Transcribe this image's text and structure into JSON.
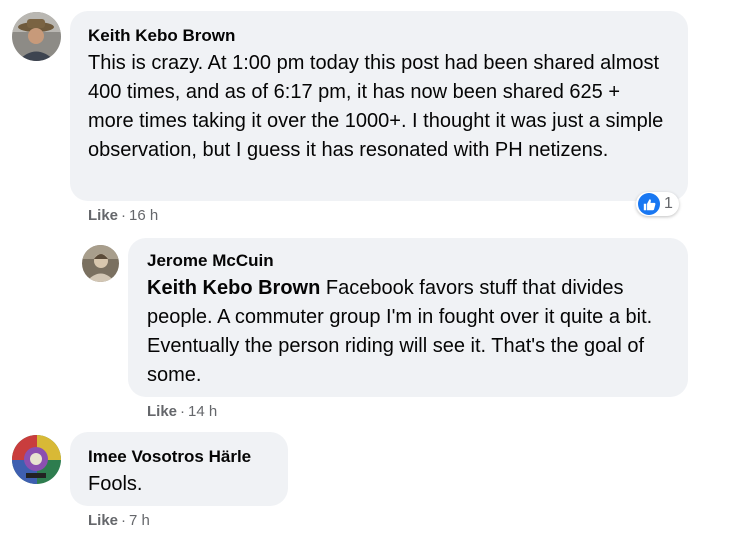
{
  "comments": [
    {
      "author": "Keith Kebo Brown",
      "text": "This is crazy. At 1:00 pm today this post had been shared almost 400 times, and as of 6:17 pm, it has now been shared 625 + more times taking it over the 1000+. I thought it was just a simple observation, but I guess it has resonated with PH netizens.",
      "like_label": "Like",
      "time": "16 h",
      "reaction_icon": "thumbs-up-icon",
      "reaction_count": "1"
    },
    {
      "author": "Jerome McCuin",
      "mention": "Keith Kebo Brown",
      "text": "Facebook favors stuff that divides people. A commuter group I'm in fought over it quite a bit. Eventually the person riding will see it. That's the goal of some.",
      "like_label": "Like",
      "time": "14 h"
    },
    {
      "author": "Imee Vosotros Härle",
      "text": "Fools.",
      "like_label": "Like",
      "time": "7 h"
    }
  ],
  "separator": "·",
  "colors": {
    "bubble": "#f0f2f5",
    "meta_text": "#65676b",
    "like_blue": "#1877f2"
  }
}
